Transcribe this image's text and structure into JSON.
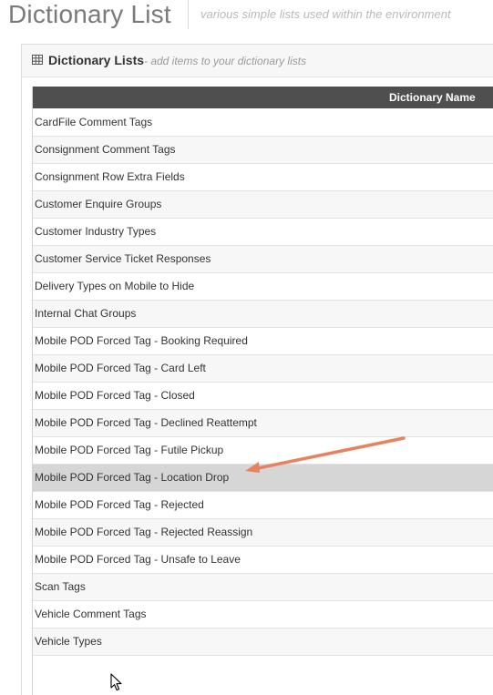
{
  "header": {
    "title": "Dictionary List",
    "subtitle": "various simple lists used within the environment"
  },
  "panel": {
    "icon": "table-icon",
    "title": "Dictionary Lists",
    "subtitle": "- add items to your dictionary lists"
  },
  "table": {
    "columns": [
      "Dictionary Name"
    ],
    "rows": [
      "CardFile Comment Tags",
      "Consignment Comment Tags",
      "Consignment Row Extra Fields",
      "Customer Enquire Groups",
      "Customer Industry Types",
      "Customer Service Ticket Responses",
      "Delivery Types on Mobile to Hide",
      "Internal Chat Groups",
      "Mobile POD Forced Tag - Booking Required",
      "Mobile POD Forced Tag - Card Left",
      "Mobile POD Forced Tag - Closed",
      "Mobile POD Forced Tag - Declined Reattempt",
      "Mobile POD Forced Tag - Futile Pickup",
      "Mobile POD Forced Tag - Location Drop",
      "Mobile POD Forced Tag - Rejected",
      "Mobile POD Forced Tag - Rejected Reassign",
      "Mobile POD Forced Tag - Unsafe to Leave",
      "Scan Tags",
      "Vehicle Comment Tags",
      "Vehicle Types"
    ],
    "highlighted_row": "Mobile POD Forced Tag - Location Drop"
  },
  "annotation": {
    "arrow_color": "#e8825e",
    "arrow_icon": "annotation-arrow-icon"
  },
  "cursor": {
    "icon": "mouse-pointer-icon"
  }
}
